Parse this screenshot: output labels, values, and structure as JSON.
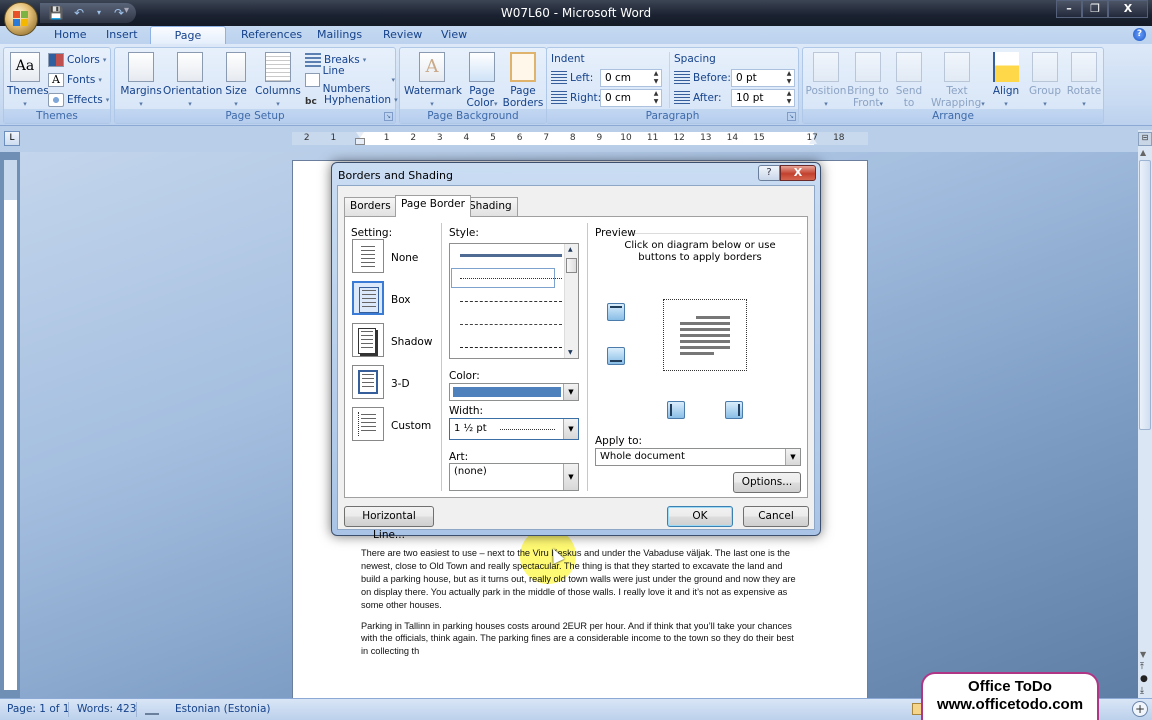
{
  "window": {
    "title": "W07L60 - Microsoft Word",
    "controls": {
      "minimize": "–",
      "restore": "❐",
      "close": "X"
    }
  },
  "quick_access": {
    "items": [
      {
        "name": "save-icon",
        "glyph": "💾"
      },
      {
        "name": "undo-icon",
        "glyph": "↶"
      },
      {
        "name": "undo-dropdown-icon",
        "glyph": "▾"
      },
      {
        "name": "redo-icon",
        "glyph": "↷"
      }
    ],
    "customize": "▾"
  },
  "ribbon_tabs": [
    "Home",
    "Insert",
    "Page Layout",
    "References",
    "Mailings",
    "Review",
    "View"
  ],
  "active_tab": "Page Layout",
  "help_glyph": "?",
  "ribbon": {
    "themes": {
      "label": "Themes",
      "themes_button": "Themes",
      "colors": "Colors",
      "fonts": "Fonts",
      "effects": "Effects"
    },
    "page_setup": {
      "label": "Page Setup",
      "margins": "Margins",
      "orientation": "Orientation",
      "size": "Size",
      "columns": "Columns",
      "breaks": "Breaks",
      "line_numbers": "Line Numbers",
      "hyphenation": "Hyphenation"
    },
    "page_background": {
      "label": "Page Background",
      "watermark": "Watermark",
      "page_color_1": "Page",
      "page_color_2": "Color",
      "page_borders_1": "Page",
      "page_borders_2": "Borders"
    },
    "paragraph": {
      "label": "Paragraph",
      "indent_title": "Indent",
      "left_label": "Left:",
      "left_value": "0 cm",
      "right_label": "Right:",
      "right_value": "0 cm",
      "spacing_title": "Spacing",
      "before_label": "Before:",
      "before_value": "0 pt",
      "after_label": "After:",
      "after_value": "10 pt"
    },
    "arrange": {
      "label": "Arrange",
      "position": "Position",
      "bring_to_front_1": "Bring to",
      "bring_to_front_2": "Front",
      "send_to_back_1": "Send to",
      "send_to_back_2": "Back",
      "text_wrapping_1": "Text",
      "text_wrapping_2": "Wrapping",
      "align": "Align",
      "group": "Group",
      "rotate": "Rotate"
    }
  },
  "ruler": {
    "tab_selector": "L",
    "numbers": [
      "2",
      "1",
      "1",
      "2",
      "3",
      "4",
      "5",
      "6",
      "7",
      "8",
      "9",
      "10",
      "11",
      "12",
      "13",
      "14",
      "15",
      "17",
      "18"
    ]
  },
  "dialog": {
    "title": "Borders and Shading",
    "help": "?",
    "close": "X",
    "tabs": [
      "Borders",
      "Page Border",
      "Shading"
    ],
    "active_tab": "Page Border",
    "setting_label": "Setting:",
    "settings": [
      "None",
      "Box",
      "Shadow",
      "3-D",
      "Custom"
    ],
    "selected_setting": "Box",
    "style_label": "Style:",
    "styles": [
      "solid",
      "dotted",
      "dashed-small",
      "dashed",
      "dash-dot"
    ],
    "selected_style": "dotted",
    "color_label": "Color:",
    "color_value": "#4f81bd",
    "width_label": "Width:",
    "width_value": "1 ½ pt",
    "art_label": "Art:",
    "art_value": "(none)",
    "preview_label": "Preview",
    "preview_hint_1": "Click on diagram below or use",
    "preview_hint_2": "buttons to apply borders",
    "apply_to_label": "Apply to:",
    "apply_to_value": "Whole document",
    "options_button": "Options...",
    "horizontal_line_button": "Horizontal Line...",
    "ok_button": "OK",
    "cancel_button": "Cancel"
  },
  "document": {
    "paragraphs": [
      "There are two easiest to use – next to the Viru Keskus and under the Vabaduse väljak. The last one is the newest, close to Old Town and really spectacular. The thing is that they started to excavate the land and build a parking house, but as it turns out, really old town walls were just under the ground and now they are on display there. You actually park in the middle of those walls. I really love it and it’s not as expensive as some other houses.",
      "Parking in Tallinn in parking houses costs around 2EUR per hour. And if think that you’ll take your chances with the officials, think again. The parking fines are a considerable income to the town so they do their best in collecting th"
    ]
  },
  "status_bar": {
    "page": "Page: 1 of 1",
    "words": "Words: 423",
    "language": "Estonian (Estonia)",
    "zoom_in": "+"
  },
  "watermark_badge": {
    "line1": "Office ToDo",
    "line2": "www.officetodo.com",
    "border_color": "#b03585"
  }
}
